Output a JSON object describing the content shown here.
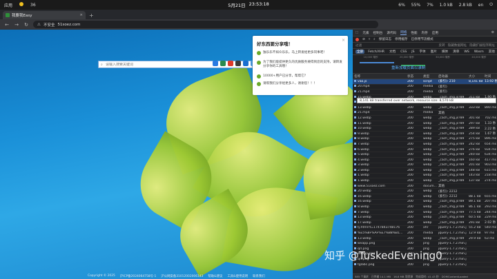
{
  "statusbar": {
    "left": [
      "应用",
      "36"
    ],
    "date": "5月21日",
    "time": "23:53:18",
    "right": [
      "6%",
      "55%",
      "7%",
      "1.0 kB",
      "2.8 kB",
      "en"
    ]
  },
  "browser": {
    "tab_title": "我要我Easy",
    "insecure_label": "不安全",
    "url": "51soez.com"
  },
  "page": {
    "search_placeholder": "请输入搜索关键词",
    "engine_colors": [
      "#2a7ae2",
      "#2a8a4e",
      "#de3a2a",
      "#3a3a3a",
      "#1a6fd0",
      "#4a9ae0",
      "#777777"
    ],
    "popup": {
      "title": "好东西要分享哦！",
      "items": [
        "独乐乐不如众乐乐，马上转发给更多同事吧！",
        "为了我们能提供更久的优质服务要得到您的支持，请转发分享你的工具哦！",
        "10000+用户已分享，帮帮它？",
        "请帮我们分享给更多人，谢谢您！！！"
      ]
    },
    "footer": [
      "Copyright © 2025",
      "沪ICP备2024064758号-1",
      "沪公网安备31012002006143",
      "帮助&建议",
      "工具&使用说明",
      "联系我们"
    ]
  },
  "devtools": {
    "tabs": [
      "元素",
      "控制台",
      "源代码",
      "网络",
      "性能",
      "内存",
      "应用"
    ],
    "active_tab": "网络",
    "toolbar": [
      "保留日志",
      "停用缓存",
      "已停用节流模式"
    ],
    "filter_placeholder": "过滤",
    "filter_options": [
      "反转",
      "隐藏数据网址",
      "隐藏扩展程序网址"
    ],
    "types": [
      "全部",
      "Fetch/XHR",
      "文档",
      "CSS",
      "JS",
      "字体",
      "图片",
      "媒体",
      "清单",
      "WS",
      "Wasm",
      "其他"
    ],
    "active_type": "全部",
    "timeline_ticks": [
      "10,000 毫秒",
      "20,000 毫秒",
      "30,000 毫秒",
      "40,000 毫秒"
    ],
    "overlay_text": "重新加载页面以录制",
    "columns": [
      "名称",
      "状态",
      "类型",
      "启动器",
      "大小",
      "时间"
    ],
    "rows": [
      [
        "vao.js",
        "200",
        "script",
        "(索引): 210",
        "8,141 kB",
        "13.92 秒"
      ],
      [
        "20.mp4",
        "200",
        "media",
        "(索引)",
        "",
        ""
      ],
      [
        "21.mp4",
        "200",
        "media",
        "(索引)",
        "",
        ""
      ],
      [
        "15.webp",
        "200",
        "webp",
        "_cach_img.js?89",
        "311 kB",
        "1.90 秒"
      ],
      [
        "14.webp",
        "200",
        "webp",
        "_cach_img.js?89",
        "368 kB",
        "955 ms"
      ],
      [
        "13.webp",
        "200",
        "webp",
        "_cach_img.js?89",
        "333 kB",
        "890 ms"
      ],
      [
        "21.mp4",
        "200",
        "media",
        "其他",
        "",
        ""
      ],
      [
        "12.webp",
        "200",
        "webp",
        "_cach_img.js?89",
        "301 kB",
        "702 ms"
      ],
      [
        "11.webp",
        "200",
        "webp",
        "_cach_img.js?89",
        "297 kB",
        "1.33 秒"
      ],
      [
        "10.webp",
        "200",
        "webp",
        "_cach_img.js?89",
        "289 kB",
        "2.22 秒"
      ],
      [
        "9.webp",
        "200",
        "webp",
        "_cach_img.js?89",
        "254 kB",
        "1.67 秒"
      ],
      [
        "8.webp",
        "200",
        "webp",
        "_cach_img.js?89",
        "275 kB",
        "896 ms"
      ],
      [
        "7.webp",
        "200",
        "webp",
        "_cach_img.js?89",
        "242 kB",
        "654 ms"
      ],
      [
        "6.webp",
        "200",
        "webp",
        "_cach_img.js?89",
        "276 kB",
        "934 ms"
      ],
      [
        "5.webp",
        "200",
        "webp",
        "_cach_img.js?89",
        "240 kB",
        "634 ms"
      ],
      [
        "4.webp",
        "200",
        "webp",
        "_cach_img.js?89",
        "160 kB",
        "417 ms"
      ],
      [
        "3.webp",
        "200",
        "webp",
        "_cach_img.js?89",
        "201 kB",
        "903 ms"
      ],
      [
        "2.webp",
        "200",
        "webp",
        "_cach_img.js?89",
        "148 kB",
        "615 ms"
      ],
      [
        "1.webp",
        "200",
        "webp",
        "_cach_img.js?89",
        "143 kB",
        "218 ms"
      ],
      [
        "1.webp",
        "200",
        "webp",
        "_cach_img.js?89",
        "137 kB",
        "274 ms"
      ],
      [
        "www.51soez.com",
        "200",
        "docum...",
        "其他",
        "",
        ""
      ],
      [
        "20.webp",
        "200",
        "webp",
        "(索引): 2212",
        "",
        ""
      ],
      [
        "16.webp",
        "200",
        "webp",
        "(索引): 2212",
        "88.1 kB",
        "655 ms"
      ],
      [
        "16.webp",
        "200",
        "webp",
        "_cach_img.js?89",
        "89.1 kB",
        "207 ms"
      ],
      [
        "8.webp",
        "200",
        "webp",
        "_cach_img.js?89",
        "86.1 kB",
        "293 ms"
      ],
      [
        "7.webp",
        "200",
        "webp",
        "_cach_img.js?89",
        "77.5 kB",
        "244 ms"
      ],
      [
        "13.webp",
        "200",
        "webp",
        "_cach_img.js?89",
        "60.5 kB",
        "229 ms"
      ],
      [
        "17.webp",
        "200",
        "webp",
        "_cach_img.js?89",
        "291 kB",
        "2.02 秒"
      ],
      [
        "tj.html?t=1747843748176",
        "200",
        "xhr",
        "jquery-1.7.2.min.j",
        "55.2 kB",
        "540 ms"
      ],
      [
        "%E5%8F%AF%E7%88%B1...",
        "200",
        "media",
        "jquery-1.7.2.min.j",
        "12.9 kB",
        "97 ms"
      ],
      [
        "13.webp",
        "200",
        "webp",
        "_cach_img.js?89",
        "29.9 kB",
        "63 ms"
      ],
      [
        "wxapp.png",
        "200",
        "png",
        "jquery-1.7.2.min.j",
        "",
        ""
      ],
      [
        "qrl.png",
        "200",
        "png",
        "jquery-1.7.2.min.j",
        "",
        ""
      ],
      [
        "wxapp.png",
        "200",
        "png",
        "jquery-1.7.2.min.j",
        "",
        ""
      ],
      [
        "qrl.png",
        "200",
        "png",
        "jquery-1.7.2.min.j",
        "",
        ""
      ],
      [
        "tglabc.png",
        "200",
        "png",
        "jquery-1.7.2.min.j",
        "",
        ""
      ]
    ],
    "tooltip": "8,141 kB transferred over network, resource size: 8,570 kB",
    "status": [
      "585 个请求",
      "已传输 14.1 MB",
      "16.8 MB 项资源",
      "完成用时: 41.43 秒",
      "DOMContentLoaded"
    ]
  },
  "watermark": "知乎 @TuskedEvening0"
}
